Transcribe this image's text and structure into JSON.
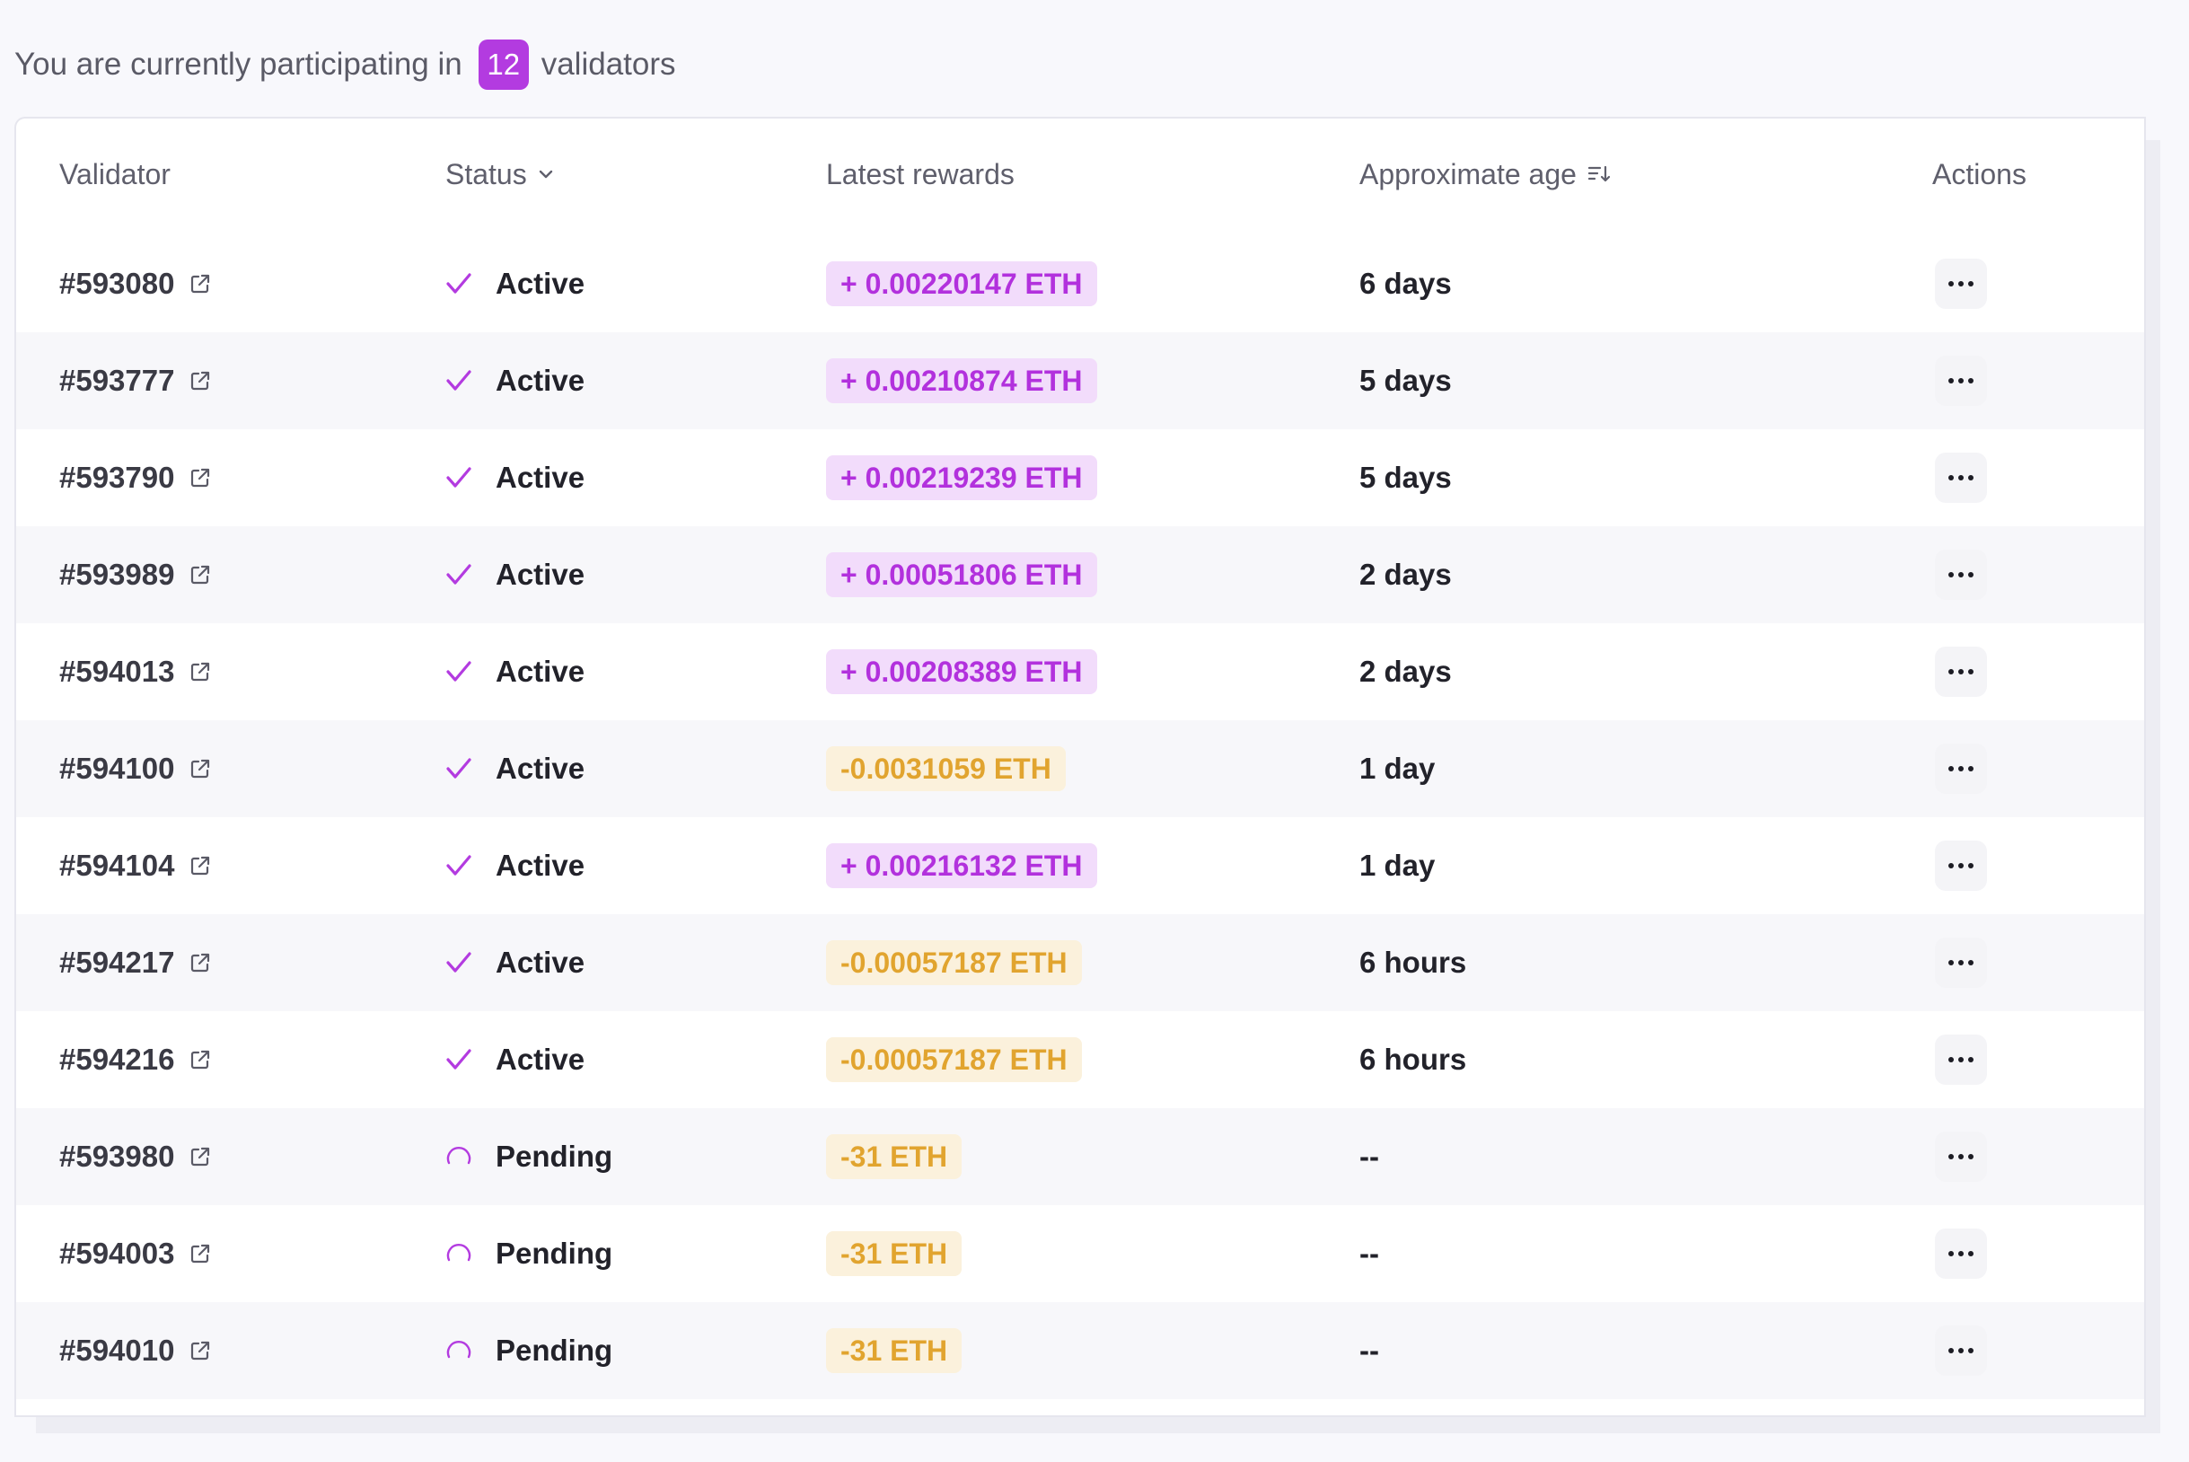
{
  "summary": {
    "prefix": "You are currently participating in",
    "count": "12",
    "suffix": "validators"
  },
  "columns": {
    "validator": "Validator",
    "status": "Status",
    "rewards": "Latest rewards",
    "age": "Approximate age",
    "actions": "Actions"
  },
  "colors": {
    "accent": "#b33be0",
    "positive_text": "#b231dd",
    "positive_bg": "#f2dcfb",
    "negative_text": "#e1a42f",
    "negative_bg": "#fbf1dc"
  },
  "rows": [
    {
      "id": "#593080",
      "status": "Active",
      "status_icon": "check-icon",
      "reward": "+ 0.00220147 ETH",
      "reward_sign": "positive",
      "age": "6 days"
    },
    {
      "id": "#593777",
      "status": "Active",
      "status_icon": "check-icon",
      "reward": "+ 0.00210874 ETH",
      "reward_sign": "positive",
      "age": "5 days"
    },
    {
      "id": "#593790",
      "status": "Active",
      "status_icon": "check-icon",
      "reward": "+ 0.00219239 ETH",
      "reward_sign": "positive",
      "age": "5 days"
    },
    {
      "id": "#593989",
      "status": "Active",
      "status_icon": "check-icon",
      "reward": "+ 0.00051806 ETH",
      "reward_sign": "positive",
      "age": "2 days"
    },
    {
      "id": "#594013",
      "status": "Active",
      "status_icon": "check-icon",
      "reward": "+ 0.00208389 ETH",
      "reward_sign": "positive",
      "age": "2 days"
    },
    {
      "id": "#594100",
      "status": "Active",
      "status_icon": "check-icon",
      "reward": "-0.0031059 ETH",
      "reward_sign": "negative",
      "age": "1 day"
    },
    {
      "id": "#594104",
      "status": "Active",
      "status_icon": "check-icon",
      "reward": "+ 0.00216132 ETH",
      "reward_sign": "positive",
      "age": "1 day"
    },
    {
      "id": "#594217",
      "status": "Active",
      "status_icon": "check-icon",
      "reward": "-0.00057187 ETH",
      "reward_sign": "negative",
      "age": "6 hours"
    },
    {
      "id": "#594216",
      "status": "Active",
      "status_icon": "check-icon",
      "reward": "-0.00057187 ETH",
      "reward_sign": "negative",
      "age": "6 hours"
    },
    {
      "id": "#593980",
      "status": "Pending",
      "status_icon": "spinner-icon",
      "reward": "-31 ETH",
      "reward_sign": "negative",
      "age": "--"
    },
    {
      "id": "#594003",
      "status": "Pending",
      "status_icon": "spinner-icon",
      "reward": "-31 ETH",
      "reward_sign": "negative",
      "age": "--"
    },
    {
      "id": "#594010",
      "status": "Pending",
      "status_icon": "spinner-icon",
      "reward": "-31 ETH",
      "reward_sign": "negative",
      "age": "--"
    }
  ]
}
